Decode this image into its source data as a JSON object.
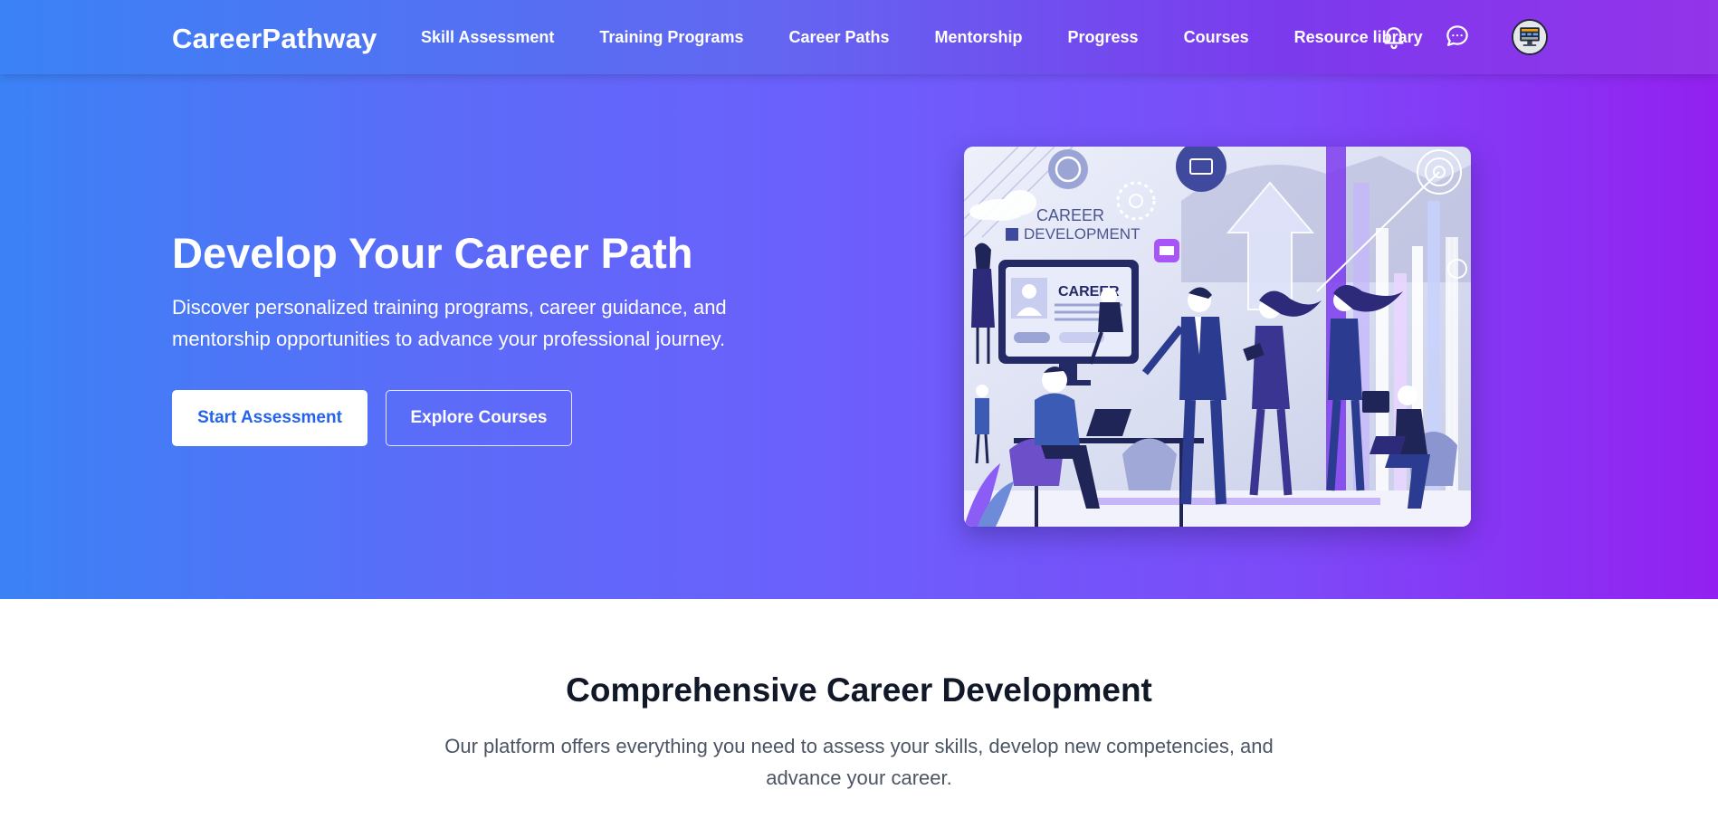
{
  "header": {
    "brand": "CareerPathway",
    "nav": [
      {
        "label": "Skill Assessment"
      },
      {
        "label": "Training Programs"
      },
      {
        "label": "Career Paths"
      },
      {
        "label": "Mentorship"
      },
      {
        "label": "Progress"
      },
      {
        "label": "Courses"
      },
      {
        "label": "Resource library"
      }
    ],
    "icons": {
      "notifications": "bell-icon",
      "messages": "chat-bubble-icon",
      "profile": "avatar"
    }
  },
  "hero": {
    "title": "Develop Your Career Path",
    "subtitle": "Discover personalized training programs, career guidance, and mentorship opportunities to advance your professional journey.",
    "primary_button": "Start Assessment",
    "secondary_button": "Explore Courses",
    "illustration": {
      "screen_label": "CAREER",
      "caption_line1": "CAREER",
      "caption_line2": "DEVELOPMENT"
    }
  },
  "features": {
    "title": "Comprehensive Career Development",
    "subtitle": "Our platform offers everything you need to assess your skills, develop new competencies, and advance your career."
  },
  "colors": {
    "gradient_start": "#3b82f6",
    "gradient_mid": "#6d5efc",
    "gradient_end": "#9320f0",
    "primary_text": "#2563eb",
    "heading_dark": "#111827",
    "body_gray": "#4b5563"
  }
}
